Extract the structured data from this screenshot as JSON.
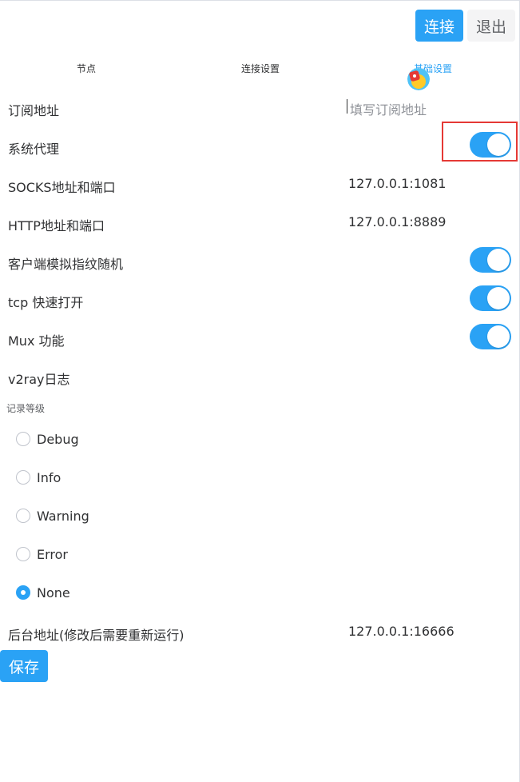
{
  "header": {
    "connect_label": "连接",
    "exit_label": "退出"
  },
  "tabs": [
    {
      "label": "节点",
      "active": false
    },
    {
      "label": "连接设置",
      "active": false
    },
    {
      "label": "基础设置",
      "active": true
    }
  ],
  "settings": {
    "subscription": {
      "label": "订阅地址",
      "placeholder": "填写订阅地址",
      "value": ""
    },
    "system_proxy": {
      "label": "系统代理",
      "on": true
    },
    "socks": {
      "label": "SOCKS地址和端口",
      "value": "127.0.0.1:1081"
    },
    "http": {
      "label": "HTTP地址和端口",
      "value": "127.0.0.1:8889"
    },
    "fingerprint": {
      "label": "客户端模拟指纹随机",
      "on": true
    },
    "tcp_fast_open": {
      "label": "tcp 快速打开",
      "on": true
    },
    "mux": {
      "label": "Mux 功能",
      "on": true
    },
    "v2ray_log": {
      "label": "v2ray日志"
    },
    "log_level": {
      "label": "记录等级",
      "options": [
        "Debug",
        "Info",
        "Warning",
        "Error",
        "None"
      ],
      "selected": "None"
    },
    "backend": {
      "label": "后台地址(修改后需要重新运行)",
      "value": "127.0.0.1:16666"
    }
  },
  "footer": {
    "save_label": "保存"
  },
  "colors": {
    "accent": "#2aa2f5",
    "highlight": "#e53935"
  }
}
